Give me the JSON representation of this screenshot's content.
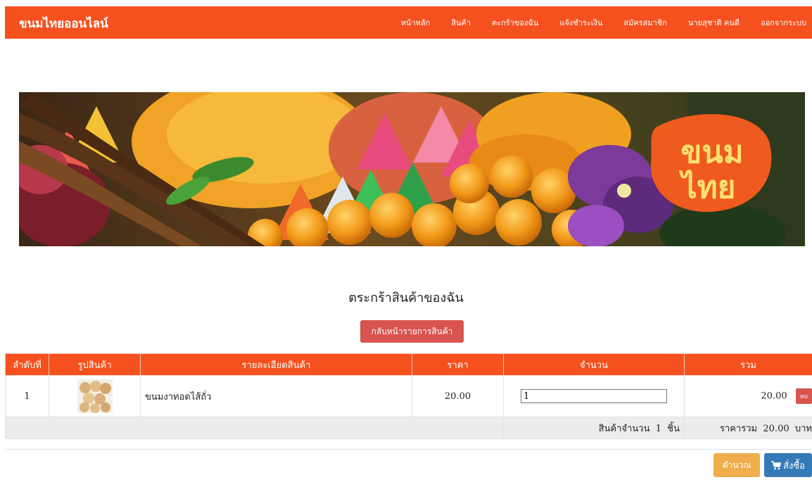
{
  "navbar": {
    "brand": "ขนมไทยออนไลน์",
    "links": [
      "หน้าหลัก",
      "สินค้า",
      "ตะกร้าของฉัน",
      "แจ้งชำระเงิน",
      "สมัครสมาชิก",
      "นายสุชาติ คนดี",
      "ออกจากระบบ"
    ],
    "color": "#f4511e"
  },
  "banner": {
    "logo_line1": "ขนม",
    "logo_line2": "ไทย"
  },
  "page": {
    "title": "ตระกร้าสินค้าของฉัน",
    "back_button": "กลับหน้ารายการสินค้า"
  },
  "cart": {
    "headers": [
      "ลำดับที่",
      "รูปสินค้า",
      "รายละเอียดสินค้า",
      "ราคา",
      "จำนวน",
      "รวม"
    ],
    "rows": [
      {
        "no": "1",
        "name": "ขนมงาทอดไส้ถั่ว",
        "price": "20.00",
        "qty": "1",
        "total": "20.00",
        "delete_label": "ลบ"
      }
    ],
    "summary": {
      "items_label": "สินค้าจำนวน",
      "items_count": "1",
      "items_unit": "ชิ้น",
      "total_label": "ราคารวม",
      "total_value": "20.00",
      "currency": "บาท"
    }
  },
  "actions": {
    "calculate": "คำนวณ",
    "order": "สั่งซื้อ",
    "order_icon": "cart-icon"
  }
}
